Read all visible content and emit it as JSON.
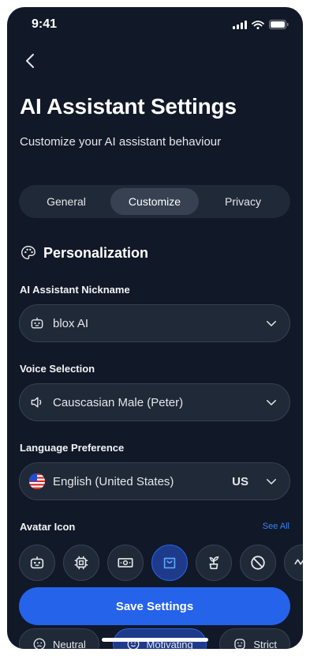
{
  "status_bar": {
    "time": "9:41"
  },
  "header": {
    "title": "AI Assistant Settings",
    "subtitle": "Customize your AI assistant behaviour"
  },
  "tabs": [
    {
      "label": "General"
    },
    {
      "label": "Customize",
      "active": true
    },
    {
      "label": "Privacy"
    }
  ],
  "section": {
    "title": "Personalization",
    "icon": "palette-icon"
  },
  "nickname": {
    "label": "AI Assistant Nickname",
    "value": "blox AI",
    "icon": "robot-icon"
  },
  "voice": {
    "label": "Voice Selection",
    "value": "Causcasian Male (Peter)",
    "icon": "speaker-icon"
  },
  "language": {
    "label": "Language Preference",
    "value": "English (United States)",
    "code": "US",
    "icon": "us-flag-icon"
  },
  "avatar": {
    "label": "Avatar Icon",
    "see_all": "See All",
    "items": [
      "robot-icon",
      "chip-icon",
      "money-icon",
      "bag-icon",
      "plant-icon",
      "blocked-icon",
      "wave-icon"
    ],
    "selected": "bag-icon"
  },
  "save_button": {
    "label": "Save Settings"
  },
  "tone": {
    "options": [
      {
        "label": "Neutral",
        "icon": "neutral-face-icon"
      },
      {
        "label": "Motivating",
        "icon": "smile-icon",
        "selected": true
      },
      {
        "label": "Strict",
        "icon": "strict-face-icon"
      }
    ]
  },
  "colors": {
    "background": "#111827",
    "surface": "#1f2937",
    "accent": "#2563eb",
    "link": "#3b82f6"
  }
}
